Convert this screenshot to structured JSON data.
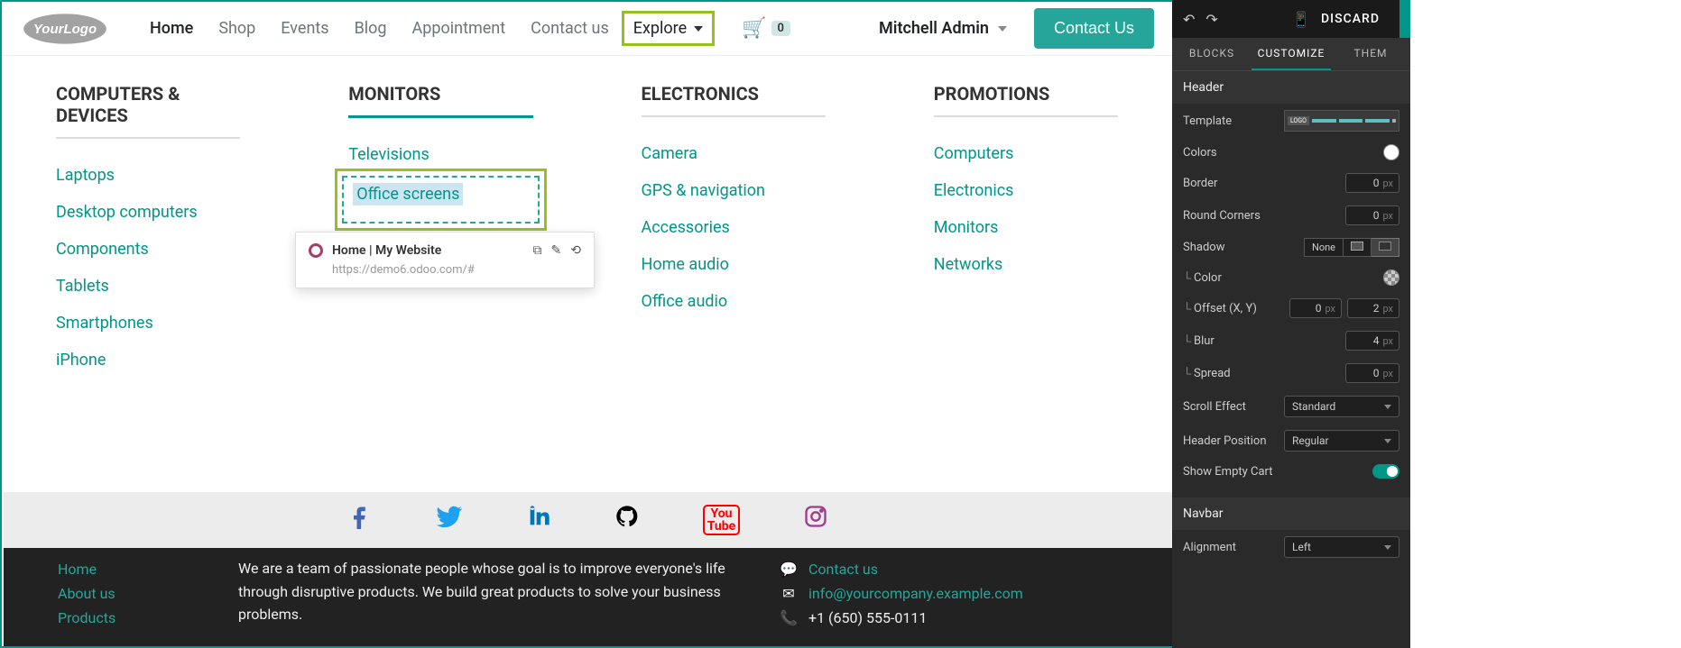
{
  "header": {
    "nav": {
      "home": "Home",
      "shop": "Shop",
      "events": "Events",
      "blog": "Blog",
      "appointment": "Appointment",
      "contact": "Contact us",
      "explore": "Explore"
    },
    "cart_count": "0",
    "user": "Mitchell Admin",
    "contact_btn": "Contact Us"
  },
  "mega": {
    "col1": {
      "title": "COMPUTERS & DEVICES",
      "items": [
        "Laptops",
        "Desktop computers",
        "Components",
        "Tablets",
        "Smartphones",
        "iPhone"
      ]
    },
    "col2": {
      "title": "MONITORS",
      "items": [
        "Televisions",
        "Office screens"
      ]
    },
    "col3": {
      "title": "ELECTRONICS",
      "items": [
        "Camera",
        "GPS & navigation",
        "Accessories",
        "Home audio",
        "Office audio"
      ]
    },
    "col4": {
      "title": "PROMOTIONS",
      "items": [
        "Computers",
        "Electronics",
        "Monitors",
        "Networks"
      ]
    }
  },
  "popover": {
    "title": "Home | My Website",
    "url": "https://demo6.odoo.com/#"
  },
  "footer": {
    "links": [
      "Home",
      "About us",
      "Products"
    ],
    "about_text": "We are a team of passionate people whose goal is to improve everyone's life through disruptive products. We build great products to solve your business problems.",
    "contact_link": "Contact us",
    "email": "info@yourcompany.example.com",
    "phone": "+1 (650) 555-0111"
  },
  "editor": {
    "discard": "DISCARD",
    "tabs": {
      "blocks": "BLOCKS",
      "customize": "CUSTOMIZE",
      "theme": "THEM"
    },
    "section_header": "Header",
    "props": {
      "template": "Template",
      "colors": "Colors",
      "border": "Border",
      "round_corners": "Round Corners",
      "shadow": "Shadow",
      "color": "Color",
      "offset": "Offset (X, Y)",
      "blur": "Blur",
      "spread": "Spread",
      "scroll_effect": "Scroll Effect",
      "header_position": "Header Position",
      "show_empty_cart": "Show Empty Cart"
    },
    "values": {
      "border": "0",
      "round_corners": "0",
      "shadow_none": "None",
      "offset_x": "0",
      "offset_y": "2",
      "blur": "4",
      "spread": "0",
      "scroll_effect": "Standard",
      "header_position": "Regular",
      "px": "px",
      "template_logo": "LOGO"
    },
    "section_navbar": "Navbar",
    "navbar": {
      "alignment_label": "Alignment",
      "alignment_value": "Left"
    }
  }
}
